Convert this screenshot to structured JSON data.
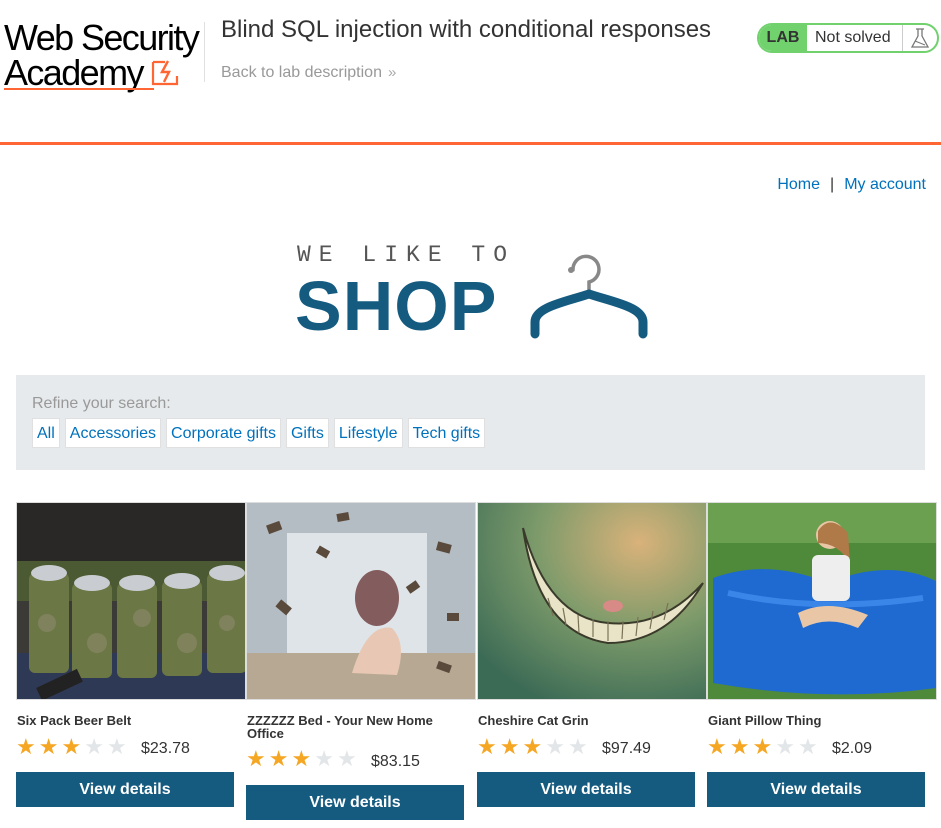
{
  "header": {
    "logo_line1": "Web Security",
    "logo_line2": "Academy",
    "lab_title": "Blind SQL injection with conditional responses",
    "back_link": "Back to lab description",
    "lab_badge": "LAB",
    "lab_status": "Not solved",
    "colors": {
      "accent": "#ff6633",
      "lab_green": "#70d16d"
    }
  },
  "nav": {
    "home": "Home",
    "separator": "|",
    "my_account": "My account"
  },
  "banner": {
    "tagline": "WE LIKE TO",
    "word": "SHOP",
    "icon": "hanger-icon",
    "color": "#155b80"
  },
  "filters": {
    "label": "Refine your search:",
    "categories": [
      "All",
      "Accessories",
      "Corporate gifts",
      "Gifts",
      "Lifestyle",
      "Tech gifts"
    ]
  },
  "products": [
    {
      "name": "Six Pack Beer Belt",
      "rating": 3,
      "max_rating": 5,
      "price": "$23.78",
      "button": "View details",
      "image": "beer-belt-image"
    },
    {
      "name": "ZZZZZZ Bed - Your New Home Office",
      "rating": 3,
      "max_rating": 5,
      "price": "$83.15",
      "button": "View details",
      "image": "flying-books-bed-image"
    },
    {
      "name": "Cheshire Cat Grin",
      "rating": 3,
      "max_rating": 5,
      "price": "$97.49",
      "button": "View details",
      "image": "cheshire-grin-image"
    },
    {
      "name": "Giant Pillow Thing",
      "rating": 3,
      "max_rating": 5,
      "price": "$2.09",
      "button": "View details",
      "image": "giant-pillow-image"
    }
  ]
}
